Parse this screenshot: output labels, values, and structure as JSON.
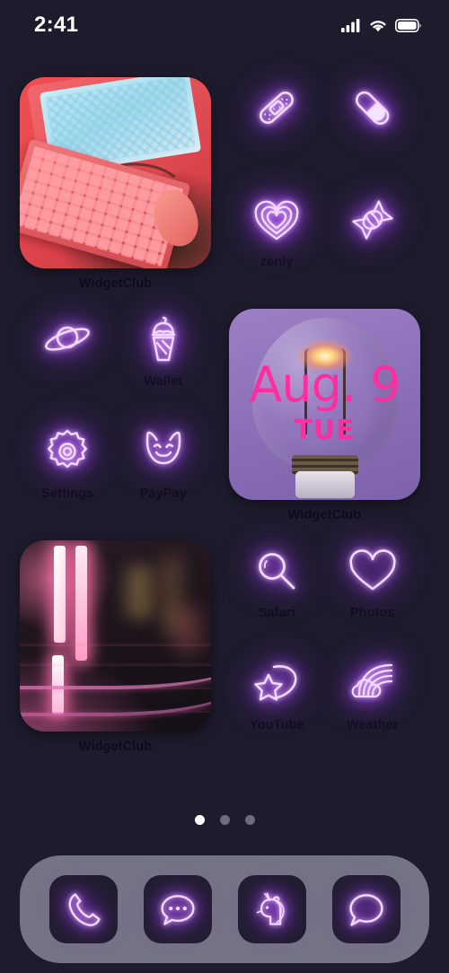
{
  "status_bar": {
    "time": "2:41",
    "signal_icon": "cellular-signal-icon",
    "wifi_icon": "wifi-icon",
    "battery_icon": "battery-full-icon"
  },
  "theme": {
    "background": "#1e1b2d",
    "neon_accent": "#a855f7",
    "neon_core": "#ffffff",
    "label_color": "#0e0b1a",
    "dock_background": "#757386",
    "date_text_color": "#ff2ea0"
  },
  "home_screen": {
    "rows": [
      {
        "left": {
          "kind": "photo-widget",
          "name": "retro-computer-widget",
          "label": "WidgetClub"
        },
        "right": {
          "kind": "icon-quad",
          "apps": [
            {
              "icon": "bandage-icon",
              "label": ""
            },
            {
              "icon": "pill-icon",
              "label": ""
            },
            {
              "icon": "heart-layered-icon",
              "label": "zenly"
            },
            {
              "icon": "candy-icon",
              "label": ""
            }
          ]
        }
      },
      {
        "left": {
          "kind": "icon-quad",
          "apps": [
            {
              "icon": "planet-saturn-icon",
              "label": ""
            },
            {
              "icon": "ice-cream-icon",
              "label": "Wallet"
            },
            {
              "icon": "gear-icon",
              "label": "Settings"
            },
            {
              "icon": "devil-face-icon",
              "label": "PayPay"
            }
          ]
        },
        "right": {
          "kind": "date-widget",
          "name": "lightbulb-date-widget",
          "date": "Aug. 9",
          "weekday": "TUE",
          "label": "WidgetClub"
        }
      },
      {
        "left": {
          "kind": "photo-widget",
          "name": "neon-tracks-widget",
          "label": "WidgetClub"
        },
        "right": {
          "kind": "icon-quad",
          "apps": [
            {
              "icon": "magnifying-glass-icon",
              "label": "Safari"
            },
            {
              "icon": "heart-outline-icon",
              "label": "Photos"
            },
            {
              "icon": "shooting-star-icon",
              "label": "YouTube"
            },
            {
              "icon": "rainbow-cloud-icon",
              "label": "Weather"
            }
          ]
        }
      }
    ]
  },
  "page_indicator": {
    "total": 3,
    "active_index": 0
  },
  "dock": {
    "apps": [
      {
        "icon": "phone-icon",
        "name": "dock-app-phone"
      },
      {
        "icon": "message-bubble-dots-icon",
        "name": "dock-app-messages"
      },
      {
        "icon": "unicorn-icon",
        "name": "dock-app-unicorn"
      },
      {
        "icon": "speech-bubble-icon",
        "name": "dock-app-chat"
      }
    ]
  }
}
